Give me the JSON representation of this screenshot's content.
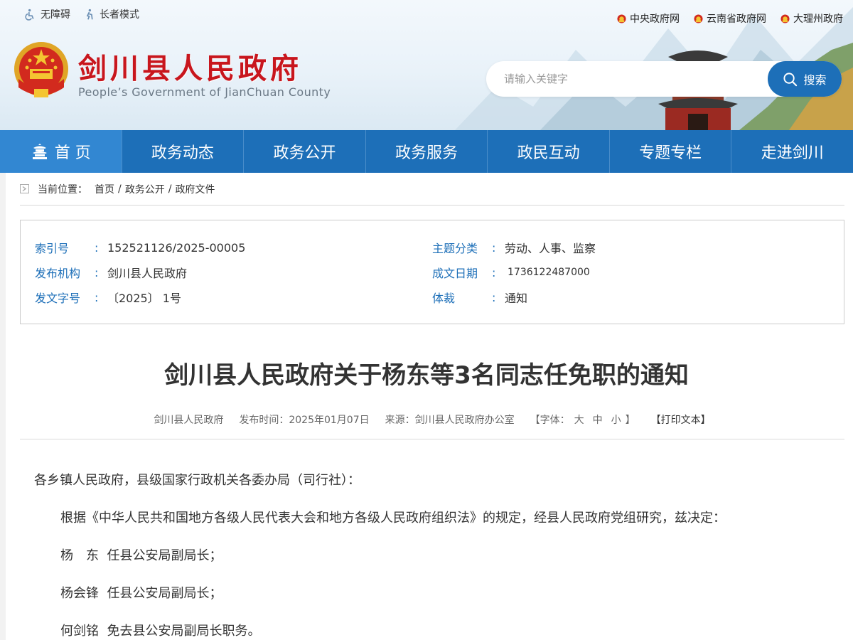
{
  "utility": {
    "accessibility_label": "无障碍",
    "elder_mode_label": "长者模式"
  },
  "gov_links": [
    {
      "label": "中央政府网"
    },
    {
      "label": "云南省政府网"
    },
    {
      "label": "大理州政府"
    }
  ],
  "header": {
    "title": "剑川县人民政府",
    "subtitle": "People’s Government of JianChuan County"
  },
  "search": {
    "placeholder": "请输入关键字",
    "button_label": "搜索"
  },
  "nav": {
    "items": [
      {
        "label": "首 页"
      },
      {
        "label": "政务动态"
      },
      {
        "label": "政务公开"
      },
      {
        "label": "政务服务"
      },
      {
        "label": "政民互动"
      },
      {
        "label": "专题专栏"
      },
      {
        "label": "走进剑川"
      }
    ]
  },
  "breadcrumb": {
    "prefix": "当前位置：",
    "items": [
      "首页",
      "政务公开",
      "政府文件"
    ],
    "separator": "/"
  },
  "meta": {
    "index_no_label": "索引号",
    "index_no": "152521126/2025-00005",
    "publisher_label": "发布机构",
    "publisher": "剑川县人民政府",
    "doc_no_label": "发文字号",
    "doc_no": "〔2025〕 1号",
    "topic_label": "主题分类",
    "topic": "劳动、人事、监察",
    "date_label": "成文日期",
    "date": "1736122487000",
    "genre_label": "体裁",
    "genre": "通知",
    "colon": ":"
  },
  "article": {
    "title": "剑川县人民政府关于杨东等3名同志任免职的通知",
    "author": "剑川县人民政府",
    "publish_time": "发布时间：2025年01月07日",
    "source": "来源：剑川县人民政府办公室",
    "font_size_prefix": "【字体：",
    "font_large": "大",
    "font_medium": "中",
    "font_small": "小",
    "font_size_suffix": "】",
    "print_label": "【打印文本】",
    "salutation": "各乡镇人民政府，县级国家行政机关各委办局（司行社）：",
    "paragraphs": [
      "根据《中华人民共和国地方各级人民代表大会和地方各级人民政府组织法》的规定，经县人民政府党组研究，兹决定：",
      "杨　东  任县公安局副局长；",
      "杨会锋  任县公安局副局长；",
      "何剑铭  免去县公安局副局长职务。"
    ]
  },
  "colors": {
    "primary_blue": "#1d6fb8",
    "nav_active": "#3287d2",
    "title_red": "#c8161d"
  }
}
